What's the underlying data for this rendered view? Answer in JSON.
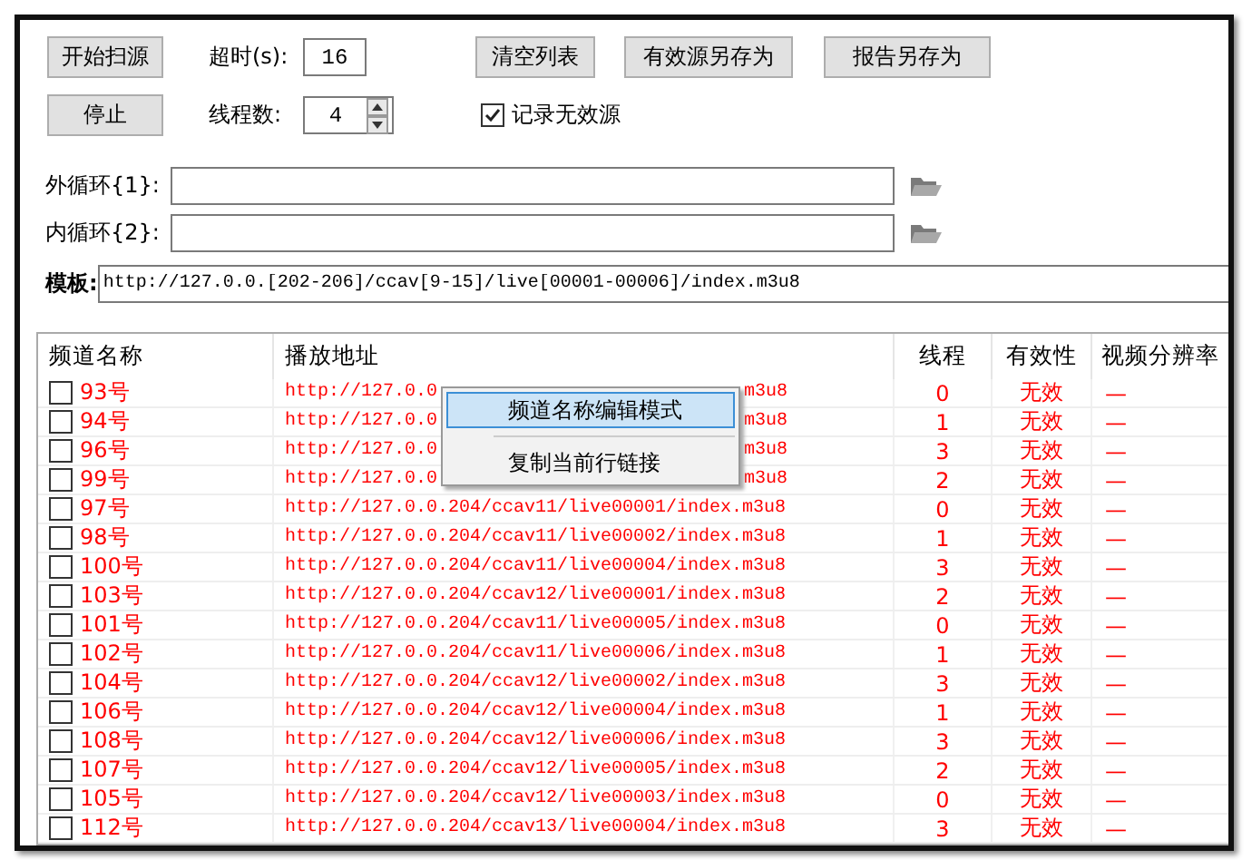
{
  "toolbar": {
    "buttons_row1": [
      {
        "label": "开始扫源"
      }
    ],
    "timeout": {
      "label": "超时(s):",
      "value": "16"
    },
    "actions": [
      {
        "label": "清空列表"
      },
      {
        "label": "有效源另存为"
      },
      {
        "label": "报告另存为"
      }
    ],
    "stop_button": {
      "label": "停止"
    },
    "threads": {
      "label": "线程数:",
      "value": "4"
    },
    "log_invalid": {
      "label": "记录无效源",
      "checked": true
    }
  },
  "outer_loop": {
    "label": "外循环{1}:"
  },
  "inner_loop": {
    "label": "内循环{2}:"
  },
  "template": {
    "label": "模板:",
    "value": "http://127.0.0.[202-206]/ccav[9-15]/live[00001-00006]/index.m3u8"
  },
  "table": {
    "columns": [
      "频道名称",
      "播放地址",
      "线程",
      "有效性",
      "视频分辨率"
    ],
    "rows": [
      {
        "checked": false,
        "name": "93号",
        "url_start": "http://127.0.0",
        "url_end": "m3u8",
        "thread": "0",
        "valid": false,
        "validity": "无效",
        "resolution": "—"
      },
      {
        "checked": false,
        "name": "94号",
        "url_start": "http://127.0.0",
        "url_end": "m3u8",
        "thread": "1",
        "valid": false,
        "validity": "无效",
        "resolution": "—"
      },
      {
        "checked": false,
        "name": "96号",
        "url_start": "http://127.0.0",
        "url_end": "m3u8",
        "thread": "3",
        "valid": false,
        "validity": "无效",
        "resolution": "—"
      },
      {
        "checked": false,
        "name": "99号",
        "url_start": "http://127.0.0",
        "url_end": "m3u8",
        "thread": "2",
        "valid": false,
        "validity": "无效",
        "resolution": "—"
      },
      {
        "checked": false,
        "name": "97号",
        "url": "http://127.0.0.204/ccav11/live00001/index.m3u8",
        "thread": "0",
        "valid": false,
        "validity": "无效",
        "resolution": "—"
      },
      {
        "checked": false,
        "name": "98号",
        "url": "http://127.0.0.204/ccav11/live00002/index.m3u8",
        "thread": "1",
        "valid": false,
        "validity": "无效",
        "resolution": "—"
      },
      {
        "checked": false,
        "name": "100号",
        "url": "http://127.0.0.204/ccav11/live00004/index.m3u8",
        "thread": "3",
        "valid": false,
        "validity": "无效",
        "resolution": "—"
      },
      {
        "checked": false,
        "name": "103号",
        "url": "http://127.0.0.204/ccav12/live00001/index.m3u8",
        "thread": "2",
        "valid": false,
        "validity": "无效",
        "resolution": "—"
      },
      {
        "checked": false,
        "name": "101号",
        "url": "http://127.0.0.204/ccav11/live00005/index.m3u8",
        "thread": "0",
        "valid": false,
        "validity": "无效",
        "resolution": "—"
      },
      {
        "checked": false,
        "name": "102号",
        "url": "http://127.0.0.204/ccav11/live00006/index.m3u8",
        "thread": "1",
        "valid": false,
        "validity": "无效",
        "resolution": "—"
      },
      {
        "checked": false,
        "name": "104号",
        "url": "http://127.0.0.204/ccav12/live00002/index.m3u8",
        "thread": "3",
        "valid": false,
        "validity": "无效",
        "resolution": "—"
      },
      {
        "checked": false,
        "name": "106号",
        "url": "http://127.0.0.204/ccav12/live00004/index.m3u8",
        "thread": "1",
        "valid": false,
        "validity": "无效",
        "resolution": "—"
      },
      {
        "checked": false,
        "name": "108号",
        "url": "http://127.0.0.204/ccav12/live00006/index.m3u8",
        "thread": "3",
        "valid": false,
        "validity": "无效",
        "resolution": "—"
      },
      {
        "checked": false,
        "name": "107号",
        "url": "http://127.0.0.204/ccav12/live00005/index.m3u8",
        "thread": "2",
        "valid": false,
        "validity": "无效",
        "resolution": "—"
      },
      {
        "checked": false,
        "name": "105号",
        "url": "http://127.0.0.204/ccav12/live00003/index.m3u8",
        "thread": "0",
        "valid": false,
        "validity": "无效",
        "resolution": "—"
      },
      {
        "checked": false,
        "name": "112号",
        "url": "http://127.0.0.204/ccav13/live00004/index.m3u8",
        "thread": "3",
        "valid": false,
        "validity": "无效",
        "resolution": "—"
      }
    ]
  },
  "context_menu": {
    "items": [
      {
        "label": "频道名称编辑模式",
        "selected": true
      },
      {
        "label": "复制当前行链接",
        "selected": false
      }
    ]
  }
}
